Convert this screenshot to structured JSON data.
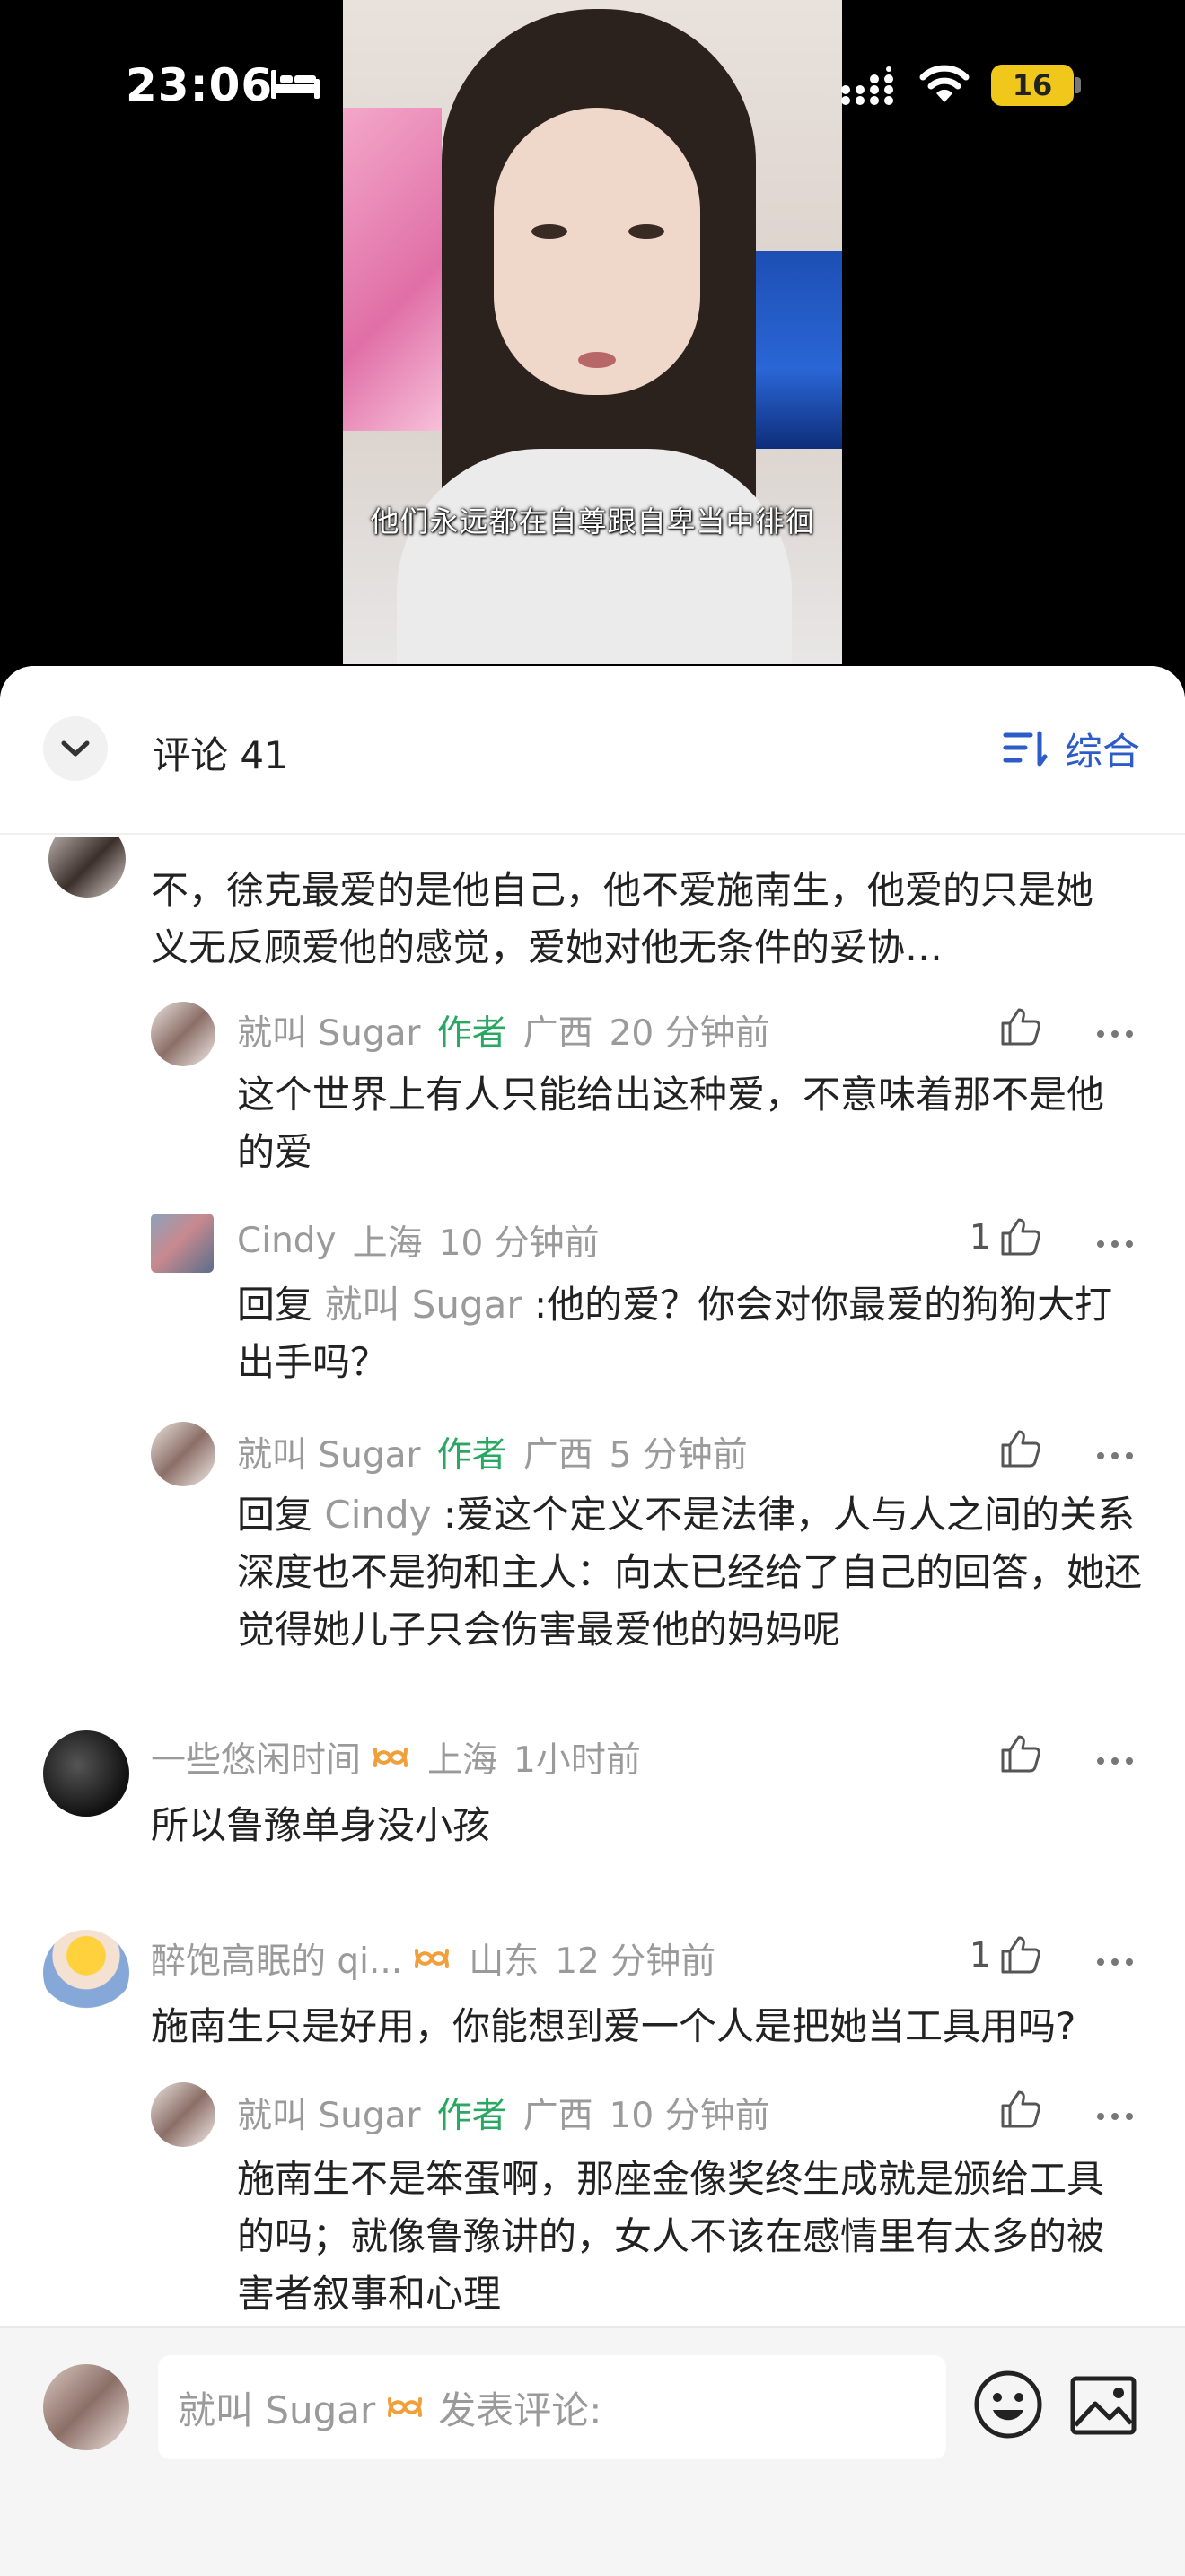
{
  "status_bar": {
    "time": "23:06",
    "battery": "16"
  },
  "video": {
    "subtitle": "他们永远都在自尊跟自卑当中徘徊"
  },
  "header": {
    "comments_title": "评论 41",
    "sort_label": "综合"
  },
  "comments": [
    {
      "body": "不，徐克最爱的是他自己，他不爱施南生，他爱的只是她义无反顾爱他的感觉，爱她对他无条件的妥协…",
      "replies": [
        {
          "author": "就叫 Sugar",
          "author_tag": "作者",
          "location": "广西",
          "time": "20 分钟前",
          "body": "这个世界上有人只能给出这种爱，不意味着那不是他的爱",
          "likes": ""
        },
        {
          "author": "Cindy",
          "location": "上海",
          "time": "10 分钟前",
          "reply_prefix": "回复",
          "reply_to": "就叫 Sugar",
          "reply_text": ":他的爱？你会对你最爱的狗狗大打出手吗？",
          "likes": "1"
        },
        {
          "author": "就叫 Sugar",
          "author_tag": "作者",
          "location": "广西",
          "time": "5 分钟前",
          "reply_prefix": "回复",
          "reply_to": "Cindy",
          "reply_text": ":爱这个定义不是法律，人与人之间的关系深度也不是狗和主人：向太已经给了自己的回答，她还觉得她儿子只会伤害最爱他的妈妈呢",
          "likes": ""
        }
      ]
    },
    {
      "author": "一些悠闲时间",
      "location": "上海",
      "time": "1小时前",
      "body": "所以鲁豫单身没小孩",
      "likes": ""
    },
    {
      "author": "醉饱高眠的 qi...",
      "location": "山东",
      "time": "12 分钟前",
      "body": "施南生只是好用，你能想到爱一个人是把她当工具用吗?",
      "likes": "1",
      "replies": [
        {
          "author": "就叫 Sugar",
          "author_tag": "作者",
          "location": "广西",
          "time": "10 分钟前",
          "body": "施南生不是笨蛋啊，那座金像奖终生成就是颁给工具的吗；就像鲁豫讲的，女人不该在感情里有太多的被害者叙事和心理",
          "likes": ""
        }
      ]
    }
  ],
  "footer": {
    "input_user": "就叫 Sugar",
    "input_placeholder": "发表评论:"
  },
  "colors": {
    "author_tag": "#2aa863",
    "accent_blue": "#2d5cc9",
    "vip_orange": "#f0a03a",
    "meta_gray": "#9a9a9a"
  },
  "icons": [
    "bed-icon",
    "cellular-signal-icon",
    "wifi-icon",
    "chevron-down-icon",
    "sort-icon",
    "thumbs-up-icon",
    "more-dots-icon",
    "vip-infinity-icon",
    "emoji-icon",
    "image-icon"
  ]
}
